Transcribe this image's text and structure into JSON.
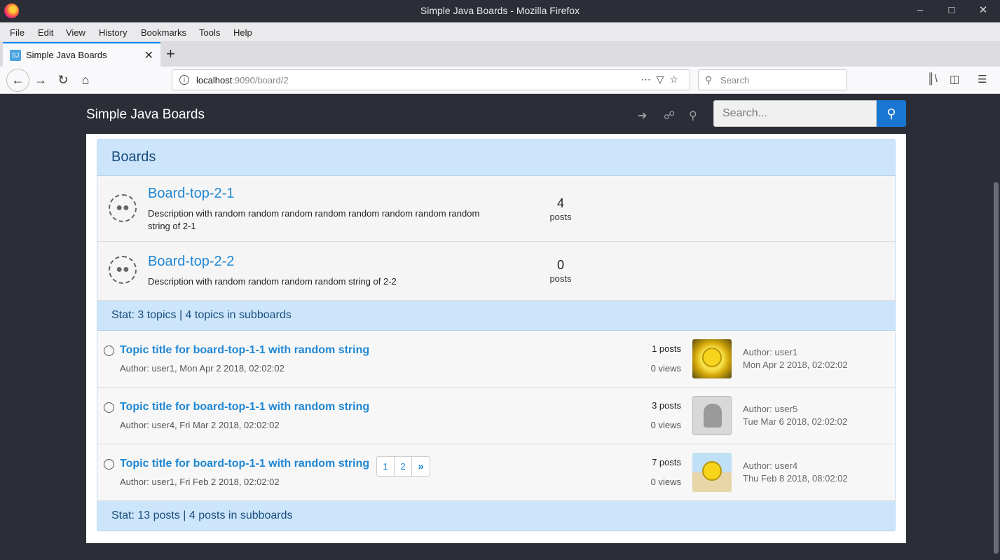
{
  "window": {
    "title": "Simple Java Boards - Mozilla Firefox",
    "controls": [
      "minimize-icon",
      "maximize-icon",
      "close-icon"
    ]
  },
  "menubar": {
    "items": [
      "File",
      "Edit",
      "View",
      "History",
      "Bookmarks",
      "Tools",
      "Help"
    ]
  },
  "tabs": [
    {
      "label": "Simple Java Boards",
      "active": true
    }
  ],
  "navbar": {
    "url_host": "localhost",
    "url_rest": ":9090/board/2",
    "search_placeholder": "Search"
  },
  "site": {
    "brand": "Simple Java Boards",
    "search_placeholder": "Search...",
    "header_icons": [
      "sign-in-icon",
      "unlock-icon",
      "key-icon"
    ]
  },
  "boards_panel": {
    "heading": "Boards",
    "boards": [
      {
        "title": "Board-top-2-1",
        "description": "Description with random random random random random random random random string of 2-1",
        "count": "4",
        "count_label": "posts"
      },
      {
        "title": "Board-top-2-2",
        "description": "Description with random random random random string of 2-2",
        "count": "0",
        "count_label": "posts"
      }
    ],
    "topic_stat": "Stat: 3 topics | 4 topics in subboards",
    "topics": [
      {
        "title": "Topic title for board-top-1-1 with random string",
        "meta": "Author: user1, Mon Apr 2 2018, 02:02:02",
        "posts": "1 posts",
        "views": "0 views",
        "last_author": "Author: user1",
        "last_date": "Mon Apr 2 2018, 02:02:02",
        "avatar": "smiley-avatar"
      },
      {
        "title": "Topic title for board-top-1-1 with random string",
        "meta": "Author: user4, Fri Mar 2 2018, 02:02:02",
        "posts": "3 posts",
        "views": "0 views",
        "last_author": "Author: user5",
        "last_date": "Tue Mar 6 2018, 02:02:02",
        "avatar": "anonymous-spy-avatar"
      },
      {
        "title": "Topic title for board-top-1-1 with random string",
        "meta": "Author: user1, Fri Feb 2 2018, 02:02:02",
        "posts": "7 posts",
        "views": "0 views",
        "last_author": "Author: user4",
        "last_date": "Thu Feb 8 2018, 08:02:02",
        "avatar": "beach-smiley-avatar",
        "pages": [
          "1",
          "2",
          "»"
        ]
      }
    ],
    "post_stat": "Stat: 13 posts | 4 posts in subboards"
  }
}
